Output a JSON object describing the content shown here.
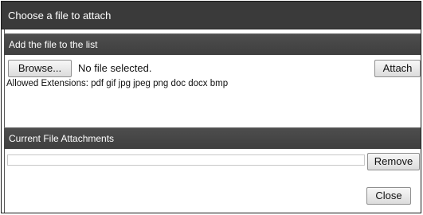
{
  "dialog": {
    "title": "Choose a file to attach"
  },
  "add_section": {
    "heading": "Add the file to the list",
    "browse_label": "Browse...",
    "file_status": "No file selected.",
    "attach_label": "Attach",
    "allowed_extensions": "Allowed Extensions:  pdf gif jpg jpeg png doc docx bmp"
  },
  "attachments_section": {
    "heading": "Current File Attachments",
    "list_value": "",
    "remove_label": "Remove",
    "close_label": "Close"
  }
}
